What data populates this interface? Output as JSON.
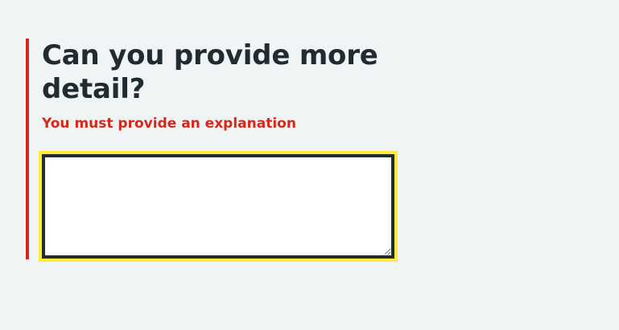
{
  "question": {
    "title": "Can you provide more detail?",
    "error": "You must provide an explanation"
  },
  "detail_field": {
    "value": "",
    "placeholder": ""
  },
  "colors": {
    "background": "#f0f4f5",
    "text": "#212b32",
    "error": "#d5281b",
    "focus": "#ffeb3b",
    "field_background": "#ffffff"
  }
}
